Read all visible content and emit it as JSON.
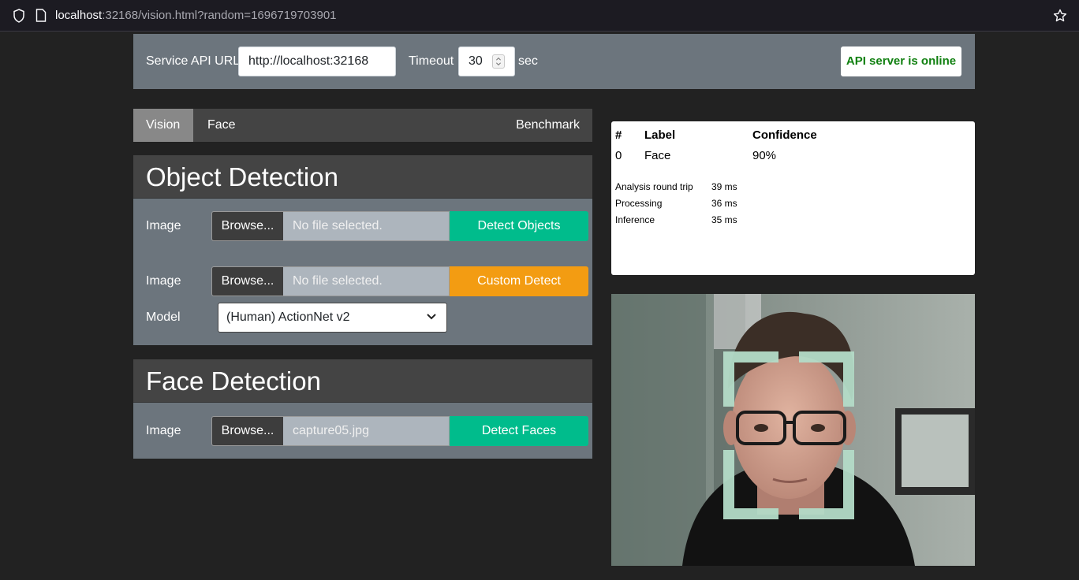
{
  "browser": {
    "url_host": "localhost",
    "url_rest": ":32168/vision.html?random=1696719703901"
  },
  "topbar": {
    "api_url_label": "Service API URL",
    "api_url_value": "http://localhost:32168",
    "timeout_label": "Timeout",
    "timeout_value": "30",
    "timeout_unit": "sec",
    "status": "API server is online",
    "status_color": "#108010"
  },
  "tabs": [
    {
      "label": "Vision",
      "active": true
    },
    {
      "label": "Face",
      "active": false
    },
    {
      "label": "Benchmark",
      "active": false
    }
  ],
  "object_detection": {
    "title": "Object Detection",
    "row1": {
      "label": "Image",
      "browse": "Browse...",
      "file": "No file selected.",
      "button": "Detect Objects"
    },
    "row2": {
      "label": "Image",
      "browse": "Browse...",
      "file": "No file selected.",
      "button": "Custom Detect"
    },
    "model_label": "Model",
    "model_value": "(Human) ActionNet v2"
  },
  "face_detection": {
    "title": "Face Detection",
    "row": {
      "label": "Image",
      "browse": "Browse...",
      "file": "capture05.jpg",
      "button": "Detect Faces"
    }
  },
  "results": {
    "headers": [
      "#",
      "Label",
      "Confidence"
    ],
    "rows": [
      {
        "index": "0",
        "label": "Face",
        "confidence": "90%"
      }
    ],
    "stats": [
      {
        "label": "Analysis round trip",
        "value": "39 ms"
      },
      {
        "label": "Processing",
        "value": "36 ms"
      },
      {
        "label": "Inference",
        "value": "35 ms"
      }
    ]
  },
  "colors": {
    "accent_green": "#00bc8c",
    "accent_orange": "#f39c12",
    "panel": "#6c757d",
    "header": "#444444",
    "detection_box": "#b4dcc8"
  }
}
